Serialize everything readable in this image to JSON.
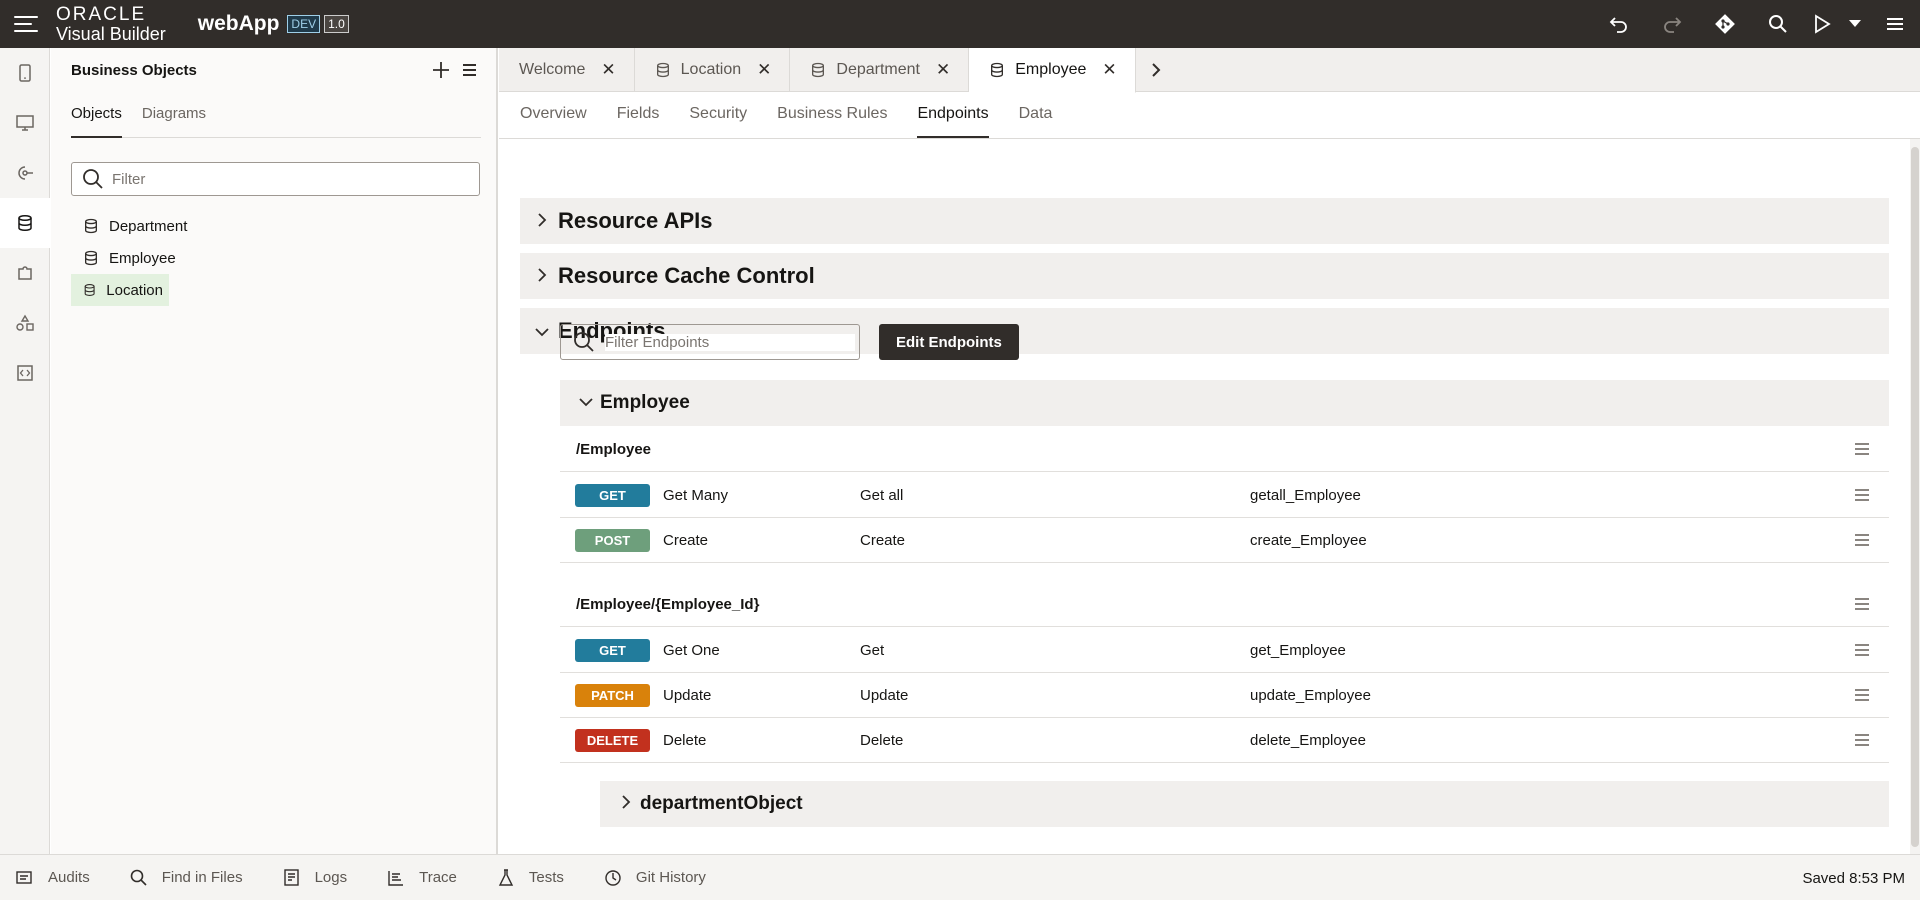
{
  "topbar": {
    "brand_oracle": "ORACLE",
    "brand_product": "Visual Builder",
    "app_name": "webApp",
    "env_badge": "DEV",
    "version_badge": "1.0"
  },
  "business_objects": {
    "title": "Business Objects",
    "tabs": [
      {
        "label": "Objects"
      },
      {
        "label": "Diagrams"
      }
    ],
    "filter_placeholder": "Filter",
    "items": [
      {
        "label": "Department"
      },
      {
        "label": "Employee"
      },
      {
        "label": "Location"
      }
    ]
  },
  "editor": {
    "tabs": [
      {
        "label": "Welcome"
      },
      {
        "label": "Location"
      },
      {
        "label": "Department"
      },
      {
        "label": "Employee"
      }
    ],
    "subtabs": [
      {
        "label": "Overview"
      },
      {
        "label": "Fields"
      },
      {
        "label": "Security"
      },
      {
        "label": "Business Rules"
      },
      {
        "label": "Endpoints"
      },
      {
        "label": "Data"
      }
    ],
    "sections": {
      "resource_apis": "Resource APIs",
      "resource_cache": "Resource Cache Control",
      "endpoints": "Endpoints"
    },
    "endpoint_filter_placeholder": "Filter Endpoints",
    "edit_endpoints_label": "Edit Endpoints",
    "group_title": "Employee",
    "paths": [
      {
        "path": "/Employee",
        "rows": [
          {
            "method": "GET",
            "color": "#227c9c",
            "name": "Get Many",
            "desc": "Get all",
            "id": "getall_Employee"
          },
          {
            "method": "POST",
            "color": "#6e9f7c",
            "name": "Create",
            "desc": "Create",
            "id": "create_Employee"
          }
        ]
      },
      {
        "path": "/Employee/{Employee_Id}",
        "rows": [
          {
            "method": "GET",
            "color": "#227c9c",
            "name": "Get One",
            "desc": "Get",
            "id": "get_Employee"
          },
          {
            "method": "PATCH",
            "color": "#d9820b",
            "name": "Update",
            "desc": "Update",
            "id": "update_Employee"
          },
          {
            "method": "DELETE",
            "color": "#c2311e",
            "name": "Delete",
            "desc": "Delete",
            "id": "delete_Employee"
          }
        ]
      }
    ],
    "child_section": "departmentObject"
  },
  "bottombar": {
    "items": [
      {
        "label": "Audits"
      },
      {
        "label": "Find in Files"
      },
      {
        "label": "Logs"
      },
      {
        "label": "Trace"
      },
      {
        "label": "Tests"
      },
      {
        "label": "Git History"
      }
    ],
    "saved_status": "Saved 8:53 PM"
  }
}
